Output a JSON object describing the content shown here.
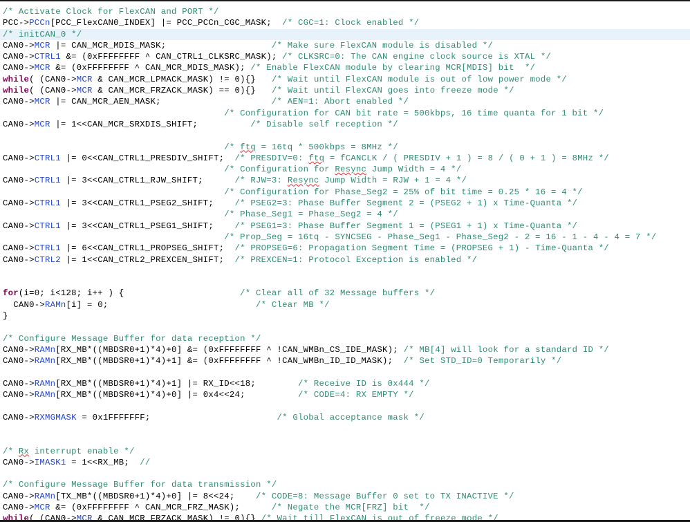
{
  "editor": {
    "language": "C",
    "theme_background": "#ffffff",
    "current_line_highlight": "#e8f2fb",
    "colors": {
      "comment": "#2e8b72",
      "keyword": "#7f0055",
      "member": "#2244cc",
      "plain": "#000000",
      "spellcheck_underline": "#e03030"
    },
    "highlighted_line_index": 2
  },
  "code": {
    "lines": [
      {
        "n": 0,
        "highlight": false,
        "tokens": [
          {
            "c": "cmt",
            "t": "/* Activate Clock for FlexCAN and PORT */"
          }
        ]
      },
      {
        "n": 1,
        "highlight": false,
        "tokens": [
          {
            "c": "pln",
            "t": "PCC->"
          },
          {
            "c": "mem",
            "t": "PCCn"
          },
          {
            "c": "pln",
            "t": "[PCC_FlexCAN0_INDEX] |= PCC_PCCn_CGC_MASK;  "
          },
          {
            "c": "cmt",
            "t": "/* CGC=1: Clock enabled */"
          }
        ]
      },
      {
        "n": 2,
        "highlight": true,
        "tokens": [
          {
            "c": "cmt",
            "t": "/* initCAN_0 */"
          }
        ]
      },
      {
        "n": 3,
        "highlight": false,
        "tokens": [
          {
            "c": "pln",
            "t": "CAN0->"
          },
          {
            "c": "mem",
            "t": "MCR"
          },
          {
            "c": "pln",
            "t": " |= CAN_MCR_MDIS_MASK;                    "
          },
          {
            "c": "cmt",
            "t": "/* Make sure FlexCAN module is disabled */"
          }
        ]
      },
      {
        "n": 4,
        "highlight": false,
        "tokens": [
          {
            "c": "pln",
            "t": "CAN0->"
          },
          {
            "c": "mem",
            "t": "CTRL1"
          },
          {
            "c": "pln",
            "t": " &= (0xFFFFFFFF ^ CAN_CTRL1_CLKSRC_MASK); "
          },
          {
            "c": "cmt",
            "t": "/* CLKSRC=0: The CAN engine clock source is XTAL */"
          }
        ]
      },
      {
        "n": 5,
        "highlight": false,
        "tokens": [
          {
            "c": "pln",
            "t": "CAN0->"
          },
          {
            "c": "mem",
            "t": "MCR"
          },
          {
            "c": "pln",
            "t": " &= (0xFFFFFFFF ^ CAN_MCR_MDIS_MASK); "
          },
          {
            "c": "cmt",
            "t": "/* Enable FlexCAN module by clearing MCR[MDIS] bit  */"
          }
        ]
      },
      {
        "n": 6,
        "highlight": false,
        "tokens": [
          {
            "c": "kw",
            "t": "while"
          },
          {
            "c": "pln",
            "t": "( (CAN0->"
          },
          {
            "c": "mem",
            "t": "MCR"
          },
          {
            "c": "pln",
            "t": " & CAN_MCR_LPMACK_MASK) != 0){}   "
          },
          {
            "c": "cmt",
            "t": "/* Wait until FlexCAN module is out of low power mode */"
          }
        ]
      },
      {
        "n": 7,
        "highlight": false,
        "tokens": [
          {
            "c": "kw",
            "t": "while"
          },
          {
            "c": "pln",
            "t": "( (CAN0->"
          },
          {
            "c": "mem",
            "t": "MCR"
          },
          {
            "c": "pln",
            "t": " & CAN_MCR_FRZACK_MASK) == 0){}   "
          },
          {
            "c": "cmt",
            "t": "/* Wait until FlexCAN goes into freeze mode */"
          }
        ]
      },
      {
        "n": 8,
        "highlight": false,
        "tokens": [
          {
            "c": "pln",
            "t": "CAN0->"
          },
          {
            "c": "mem",
            "t": "MCR"
          },
          {
            "c": "pln",
            "t": " |= CAN_MCR_AEN_MASK;                     "
          },
          {
            "c": "cmt",
            "t": "/* AEN=1: Abort enabled */"
          }
        ]
      },
      {
        "n": 9,
        "highlight": false,
        "tokens": [
          {
            "c": "pln",
            "t": "                                          "
          },
          {
            "c": "cmt",
            "t": "/* Configuration for CAN bit rate = 500kbps, 16 time quanta for 1 bit */"
          }
        ]
      },
      {
        "n": 10,
        "highlight": false,
        "tokens": [
          {
            "c": "pln",
            "t": "CAN0->"
          },
          {
            "c": "mem",
            "t": "MCR"
          },
          {
            "c": "pln",
            "t": " |= 1<<CAN_MCR_SRXDIS_SHIFT;          "
          },
          {
            "c": "cmt",
            "t": "/* Disable self reception */"
          }
        ]
      },
      {
        "n": 11,
        "highlight": false,
        "tokens": [
          {
            "c": "pln",
            "t": ""
          }
        ]
      },
      {
        "n": 12,
        "highlight": false,
        "tokens": [
          {
            "c": "pln",
            "t": "                                          "
          },
          {
            "c": "cmt",
            "t": "/* "
          },
          {
            "c": "cmt",
            "t": "ftq",
            "sp": true
          },
          {
            "c": "cmt",
            "t": " = 16tq * 500kbps = 8MHz */"
          }
        ]
      },
      {
        "n": 13,
        "highlight": false,
        "tokens": [
          {
            "c": "pln",
            "t": "CAN0->"
          },
          {
            "c": "mem",
            "t": "CTRL1"
          },
          {
            "c": "pln",
            "t": " |= 0<<CAN_CTRL1_PRESDIV_SHIFT;  "
          },
          {
            "c": "cmt",
            "t": "/* PRESDIV=0: "
          },
          {
            "c": "cmt",
            "t": "ftq",
            "sp": true
          },
          {
            "c": "cmt",
            "t": " = fCANCLK / ( PRESDIV + 1 ) = 8 / ( 0 + 1 ) = 8MHz */"
          }
        ]
      },
      {
        "n": 14,
        "highlight": false,
        "tokens": [
          {
            "c": "pln",
            "t": "                                          "
          },
          {
            "c": "cmt",
            "t": "/* Configuration for "
          },
          {
            "c": "cmt",
            "t": "Resync",
            "sp": true
          },
          {
            "c": "cmt",
            "t": " Jump Width = 4 */"
          }
        ]
      },
      {
        "n": 15,
        "highlight": false,
        "tokens": [
          {
            "c": "pln",
            "t": "CAN0->"
          },
          {
            "c": "mem",
            "t": "CTRL1"
          },
          {
            "c": "pln",
            "t": " |= 3<<CAN_CTRL1_RJW_SHIFT;      "
          },
          {
            "c": "cmt",
            "t": "/* RJW=3: "
          },
          {
            "c": "cmt",
            "t": "Resync",
            "sp": true
          },
          {
            "c": "cmt",
            "t": " Jump Width = RJW + 1 = 4 */"
          }
        ]
      },
      {
        "n": 16,
        "highlight": false,
        "tokens": [
          {
            "c": "pln",
            "t": "                                          "
          },
          {
            "c": "cmt",
            "t": "/* Configuration for Phase_Seg2 = 25% of bit time = 0.25 * 16 = 4 */"
          }
        ]
      },
      {
        "n": 17,
        "highlight": false,
        "tokens": [
          {
            "c": "pln",
            "t": "CAN0->"
          },
          {
            "c": "mem",
            "t": "CTRL1"
          },
          {
            "c": "pln",
            "t": " |= 3<<CAN_CTRL1_PSEG2_SHIFT;    "
          },
          {
            "c": "cmt",
            "t": "/* PSEG2=3: Phase Buffer Segment 2 = (PSEG2 + 1) x Time-Quanta */"
          }
        ]
      },
      {
        "n": 18,
        "highlight": false,
        "tokens": [
          {
            "c": "pln",
            "t": "                                          "
          },
          {
            "c": "cmt",
            "t": "/* Phase_Seg1 = Phase_Seg2 = 4 */"
          }
        ]
      },
      {
        "n": 19,
        "highlight": false,
        "tokens": [
          {
            "c": "pln",
            "t": "CAN0->"
          },
          {
            "c": "mem",
            "t": "CTRL1"
          },
          {
            "c": "pln",
            "t": " |= 3<<CAN_CTRL1_PSEG1_SHIFT;    "
          },
          {
            "c": "cmt",
            "t": "/* PSEG1=3: Phase Buffer Segment 1 = (PSEG1 + 1) x Time-Quanta */"
          }
        ]
      },
      {
        "n": 20,
        "highlight": false,
        "tokens": [
          {
            "c": "pln",
            "t": "                                          "
          },
          {
            "c": "cmt",
            "t": "/* Prop_Seg = 16tq - SYNCSEG - Phase_Seg1 - Phase_Seg2 - 2 = 16 - 1 - 4 - 4 = 7 */"
          }
        ]
      },
      {
        "n": 21,
        "highlight": false,
        "tokens": [
          {
            "c": "pln",
            "t": "CAN0->"
          },
          {
            "c": "mem",
            "t": "CTRL1"
          },
          {
            "c": "pln",
            "t": " |= 6<<CAN_CTRL1_PROPSEG_SHIFT;  "
          },
          {
            "c": "cmt",
            "t": "/* PROPSEG=6: Propagation Segment Time = (PROPSEG + 1) - Time-Quanta */"
          }
        ]
      },
      {
        "n": 22,
        "highlight": false,
        "tokens": [
          {
            "c": "pln",
            "t": "CAN0->"
          },
          {
            "c": "mem",
            "t": "CTRL2"
          },
          {
            "c": "pln",
            "t": " |= 1<<CAN_CTRL2_PREXCEN_SHIFT;  "
          },
          {
            "c": "cmt",
            "t": "/* PREXCEN=1: Protocol Exception is enabled */"
          }
        ]
      },
      {
        "n": 23,
        "highlight": false,
        "tokens": [
          {
            "c": "pln",
            "t": ""
          }
        ]
      },
      {
        "n": 24,
        "highlight": false,
        "tokens": [
          {
            "c": "pln",
            "t": ""
          }
        ]
      },
      {
        "n": 25,
        "highlight": false,
        "tokens": [
          {
            "c": "kw",
            "t": "for"
          },
          {
            "c": "pln",
            "t": "(i=0; i<128; i++ ) {                      "
          },
          {
            "c": "cmt",
            "t": "/* Clear all of 32 Message buffers */"
          }
        ]
      },
      {
        "n": 26,
        "highlight": false,
        "tokens": [
          {
            "c": "pln",
            "t": "  CAN0->"
          },
          {
            "c": "mem",
            "t": "RAMn"
          },
          {
            "c": "pln",
            "t": "[i] = 0;                            "
          },
          {
            "c": "cmt",
            "t": "/* Clear MB */"
          }
        ]
      },
      {
        "n": 27,
        "highlight": false,
        "tokens": [
          {
            "c": "pln",
            "t": "}"
          }
        ]
      },
      {
        "n": 28,
        "highlight": false,
        "tokens": [
          {
            "c": "pln",
            "t": ""
          }
        ]
      },
      {
        "n": 29,
        "highlight": false,
        "tokens": [
          {
            "c": "cmt",
            "t": "/* Configure Message Buffer for data reception */"
          }
        ]
      },
      {
        "n": 30,
        "highlight": false,
        "tokens": [
          {
            "c": "pln",
            "t": "CAN0->"
          },
          {
            "c": "mem",
            "t": "RAMn"
          },
          {
            "c": "pln",
            "t": "[RX_MB*((MBDSR0+1)*4)+0] &= (0xFFFFFFFF ^ !CAN_WMBn_CS_IDE_MASK); "
          },
          {
            "c": "cmt",
            "t": "/* MB[4] will look for a standard ID */"
          }
        ]
      },
      {
        "n": 31,
        "highlight": false,
        "tokens": [
          {
            "c": "pln",
            "t": "CAN0->"
          },
          {
            "c": "mem",
            "t": "RAMn"
          },
          {
            "c": "pln",
            "t": "[RX_MB*((MBDSR0+1)*4)+1] &= (0xFFFFFFFF ^ !CAN_WMBn_ID_ID_MASK);  "
          },
          {
            "c": "cmt",
            "t": "/* Set STD_ID=0 Temporarily */"
          }
        ]
      },
      {
        "n": 32,
        "highlight": false,
        "tokens": [
          {
            "c": "pln",
            "t": ""
          }
        ]
      },
      {
        "n": 33,
        "highlight": false,
        "tokens": [
          {
            "c": "pln",
            "t": "CAN0->"
          },
          {
            "c": "mem",
            "t": "RAMn"
          },
          {
            "c": "pln",
            "t": "[RX_MB*((MBDSR0+1)*4)+1] |= RX_ID<<18;        "
          },
          {
            "c": "cmt",
            "t": "/* Receive ID is 0x444 */"
          }
        ]
      },
      {
        "n": 34,
        "highlight": false,
        "tokens": [
          {
            "c": "pln",
            "t": "CAN0->"
          },
          {
            "c": "mem",
            "t": "RAMn"
          },
          {
            "c": "pln",
            "t": "[RX_MB*((MBDSR0+1)*4)+0] |= 0x4<<24;          "
          },
          {
            "c": "cmt",
            "t": "/* CODE=4: RX EMPTY */"
          }
        ]
      },
      {
        "n": 35,
        "highlight": false,
        "tokens": [
          {
            "c": "pln",
            "t": ""
          }
        ]
      },
      {
        "n": 36,
        "highlight": false,
        "tokens": [
          {
            "c": "pln",
            "t": "CAN0->"
          },
          {
            "c": "mem",
            "t": "RXMGMASK"
          },
          {
            "c": "pln",
            "t": " = 0x1FFFFFFF;                        "
          },
          {
            "c": "cmt",
            "t": "/* Global acceptance mask */"
          }
        ]
      },
      {
        "n": 37,
        "highlight": false,
        "tokens": [
          {
            "c": "pln",
            "t": ""
          }
        ]
      },
      {
        "n": 38,
        "highlight": false,
        "tokens": [
          {
            "c": "pln",
            "t": ""
          }
        ]
      },
      {
        "n": 39,
        "highlight": false,
        "tokens": [
          {
            "c": "cmt",
            "t": "/* "
          },
          {
            "c": "cmt",
            "t": "Rx",
            "sp": true
          },
          {
            "c": "cmt",
            "t": " interrupt enable */"
          }
        ]
      },
      {
        "n": 40,
        "highlight": false,
        "tokens": [
          {
            "c": "pln",
            "t": "CAN0->"
          },
          {
            "c": "mem",
            "t": "IMASK1"
          },
          {
            "c": "pln",
            "t": " = 1<<RX_MB;  "
          },
          {
            "c": "cmt",
            "t": "//"
          }
        ]
      },
      {
        "n": 41,
        "highlight": false,
        "tokens": [
          {
            "c": "pln",
            "t": ""
          }
        ]
      },
      {
        "n": 42,
        "highlight": false,
        "tokens": [
          {
            "c": "cmt",
            "t": "/* Configure Message Buffer for data transmission */"
          }
        ]
      },
      {
        "n": 43,
        "highlight": false,
        "tokens": [
          {
            "c": "pln",
            "t": "CAN0->"
          },
          {
            "c": "mem",
            "t": "RAMn"
          },
          {
            "c": "pln",
            "t": "[TX_MB*((MBDSR0+1)*4)+0] |= 8<<24;    "
          },
          {
            "c": "cmt",
            "t": "/* CODE=8: Message Buffer 0 set to TX INACTIVE */"
          }
        ]
      },
      {
        "n": 44,
        "highlight": false,
        "tokens": [
          {
            "c": "pln",
            "t": "CAN0->"
          },
          {
            "c": "mem",
            "t": "MCR"
          },
          {
            "c": "pln",
            "t": " &= (0xFFFFFFFF ^ CAN_MCR_FRZ_MASK);      "
          },
          {
            "c": "cmt",
            "t": "/* Negate the MCR[FRZ] bit  */"
          }
        ]
      },
      {
        "n": 45,
        "highlight": false,
        "tokens": [
          {
            "c": "kw",
            "t": "while"
          },
          {
            "c": "pln",
            "t": "( (CAN0->"
          },
          {
            "c": "mem",
            "t": "MCR"
          },
          {
            "c": "pln",
            "t": " & CAN_MCR_FRZACK_MASK) != 0){} "
          },
          {
            "c": "cmt",
            "t": "/* Wait till FlexCAN is out of freeze mode */"
          }
        ]
      }
    ]
  }
}
